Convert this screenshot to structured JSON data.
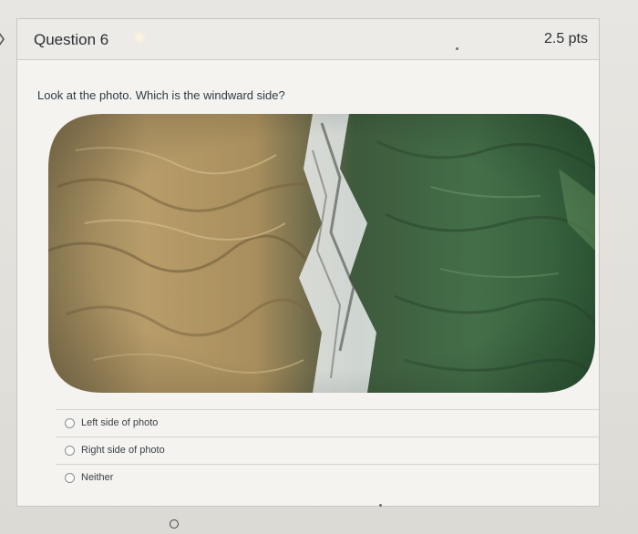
{
  "question": {
    "title": "Question 6",
    "points": "2.5 pts",
    "prompt": "Look at the photo. Which is the windward side?"
  },
  "photo": {
    "icon": "satellite-mountain-photo",
    "left_color": "#b59a68",
    "right_color": "#3f6b46",
    "snow_color": "#eef1f2"
  },
  "answers": [
    {
      "label": "Left side of photo",
      "selected": false
    },
    {
      "label": "Right side of photo",
      "selected": false
    },
    {
      "label": "Neither",
      "selected": false
    }
  ]
}
